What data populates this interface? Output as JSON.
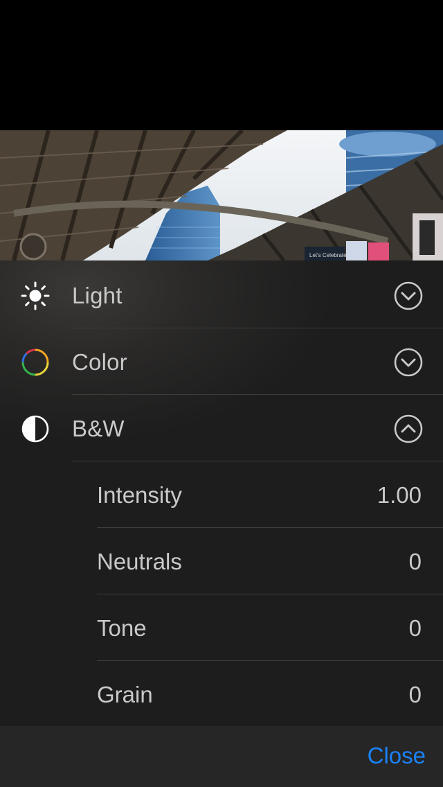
{
  "photo": {
    "sign_text": "Let's Celebrate!"
  },
  "adjustments": {
    "light": {
      "label": "Light",
      "icon": "sun-icon",
      "state": "collapsed"
    },
    "color": {
      "label": "Color",
      "icon": "color-wheel-icon",
      "state": "collapsed"
    },
    "bw": {
      "label": "B&W",
      "icon": "half-circle-icon",
      "state": "expanded",
      "params": [
        {
          "label": "Intensity",
          "value": "1.00"
        },
        {
          "label": "Neutrals",
          "value": "0"
        },
        {
          "label": "Tone",
          "value": "0"
        },
        {
          "label": "Grain",
          "value": "0"
        }
      ]
    }
  },
  "toolbar": {
    "close_label": "Close"
  },
  "colors": {
    "accent": "#1a82f7",
    "text": "#c9c9c9",
    "panel": "#1d1d1d",
    "bar": "#262626"
  }
}
